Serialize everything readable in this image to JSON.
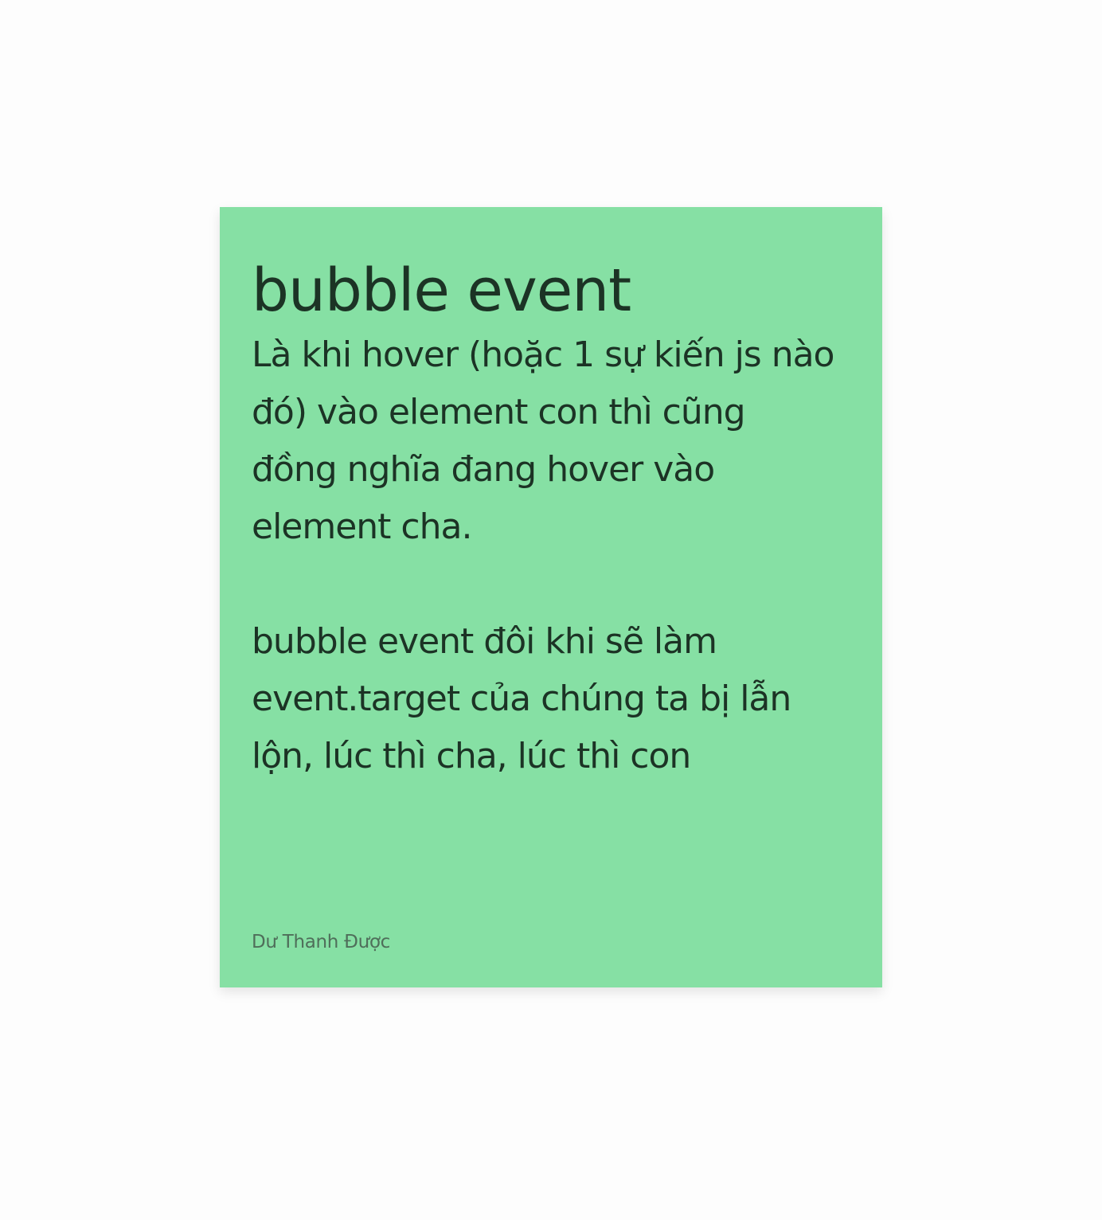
{
  "card": {
    "title": "bubble event",
    "paragraph_1_lines": [
      "Là khi hover (hoặc 1 sự kiến js nào",
      "đó) vào element con thì cũng",
      "đồng nghĩa đang hover vào",
      "element cha."
    ],
    "paragraph_2_lines": [
      "bubble event đôi khi sẽ làm",
      "event.target của chúng ta bị lẫn",
      "lộn, lúc thì cha, lúc thì con"
    ],
    "author": "Dư Thanh Được"
  },
  "colors": {
    "card_background": "#86e0a4",
    "text": "#1c3325",
    "author_text": "#4f6e5a",
    "page_background": "#fdfdfd"
  }
}
